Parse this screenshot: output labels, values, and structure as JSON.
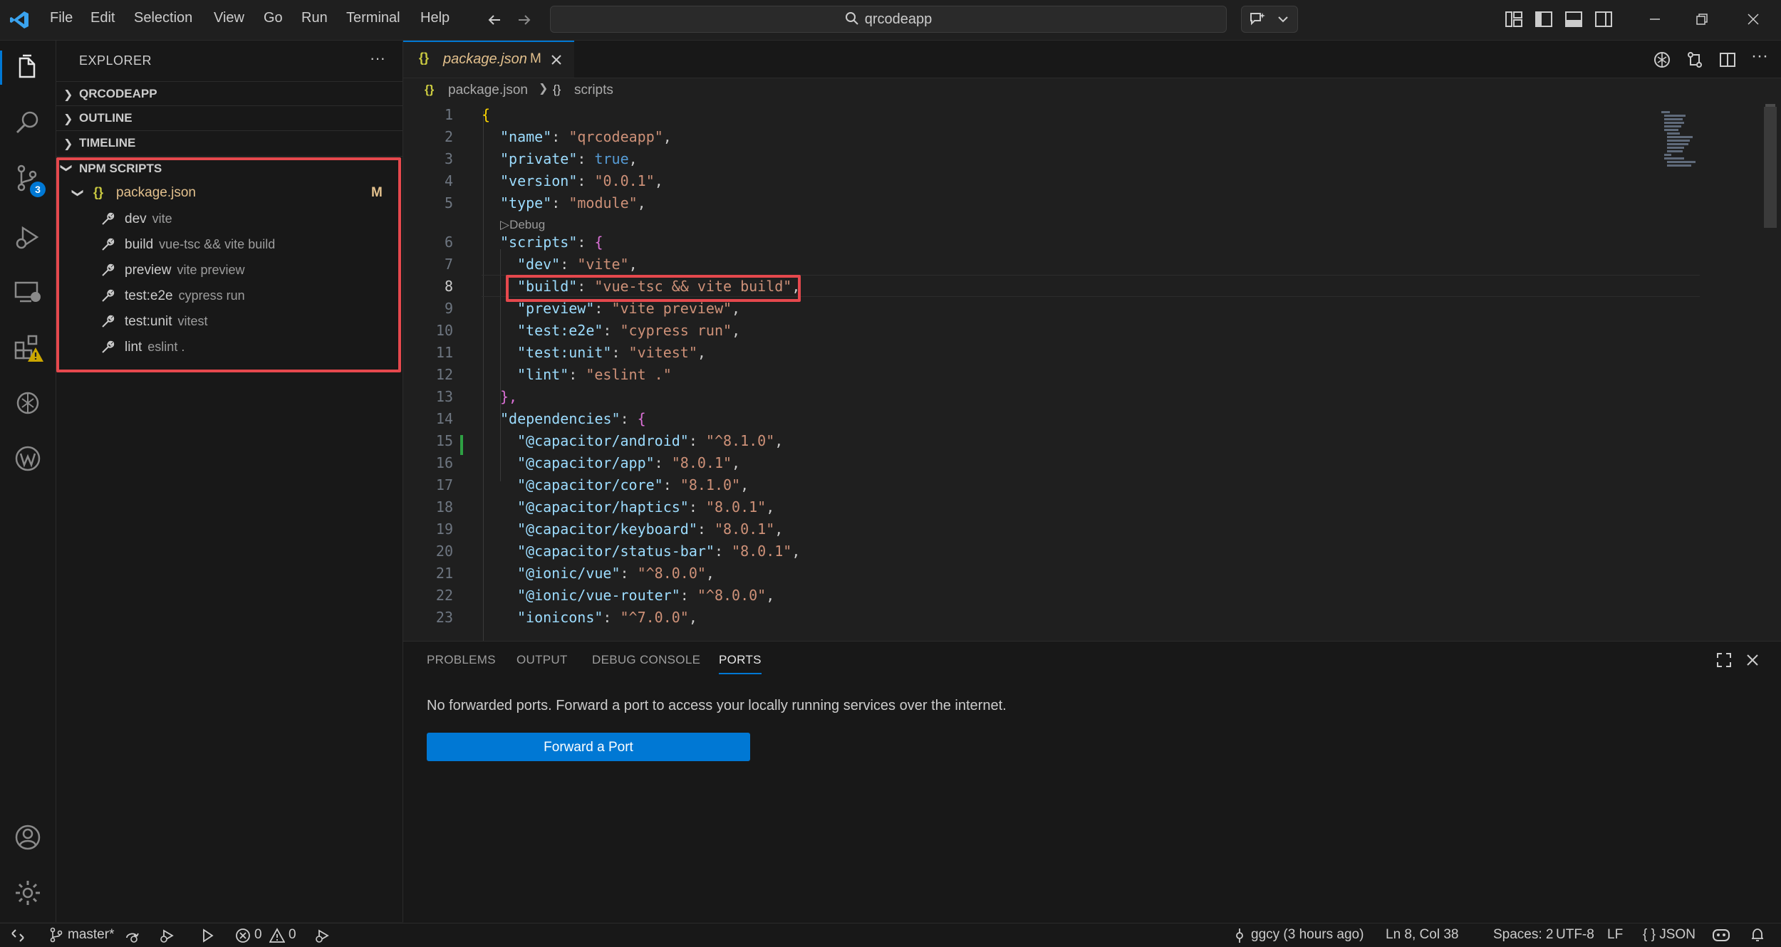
{
  "window": {
    "search": "qrcodeapp"
  },
  "menu": [
    "File",
    "Edit",
    "Selection",
    "View",
    "Go",
    "Run",
    "Terminal",
    "Help"
  ],
  "activity": {
    "scm_badge": "3"
  },
  "sidebar": {
    "title": "EXPLORER",
    "sections": [
      {
        "label": "QRCODEAPP"
      },
      {
        "label": "OUTLINE"
      },
      {
        "label": "TIMELINE"
      },
      {
        "label": "NPM SCRIPTS"
      }
    ],
    "npm": {
      "file": "package.json",
      "file_status": "M",
      "scripts": [
        {
          "name": "dev",
          "cmd": "vite"
        },
        {
          "name": "build",
          "cmd": "vue-tsc && vite build"
        },
        {
          "name": "preview",
          "cmd": "vite preview"
        },
        {
          "name": "test:e2e",
          "cmd": "cypress run"
        },
        {
          "name": "test:unit",
          "cmd": "vitest"
        },
        {
          "name": "lint",
          "cmd": "eslint ."
        }
      ]
    }
  },
  "editor": {
    "tab": {
      "label": "package.json",
      "status": "M"
    },
    "breadcrumb": [
      "package.json",
      "scripts"
    ],
    "codelens": "Debug",
    "line_numbers": [
      "1",
      "2",
      "3",
      "4",
      "5",
      "6",
      "7",
      "8",
      "9",
      "10",
      "11",
      "12",
      "13",
      "14",
      "15",
      "16",
      "17",
      "18",
      "19",
      "20",
      "21",
      "22",
      "23"
    ],
    "code": {
      "l1": "{",
      "l2": {
        "key": "\"name\"",
        "val": "\"qrcodeapp\""
      },
      "l3": {
        "key": "\"private\"",
        "val": "true"
      },
      "l4": {
        "key": "\"version\"",
        "val": "\"0.0.1\""
      },
      "l5": {
        "key": "\"type\"",
        "val": "\"module\""
      },
      "l6": {
        "key": "\"scripts\"",
        "val": "{"
      },
      "l7": {
        "key": "\"dev\"",
        "val": "\"vite\""
      },
      "l8": {
        "key": "\"build\"",
        "val": "\"vue-tsc && vite build\""
      },
      "l9": {
        "key": "\"preview\"",
        "val": "\"vite preview\""
      },
      "l10": {
        "key": "\"test:e2e\"",
        "val": "\"cypress run\""
      },
      "l11": {
        "key": "\"test:unit\"",
        "val": "\"vitest\""
      },
      "l12": {
        "key": "\"lint\"",
        "val": "\"eslint .\""
      },
      "l13": "},",
      "l14": {
        "key": "\"dependencies\"",
        "val": "{"
      },
      "l15": {
        "key": "\"@capacitor/android\"",
        "val": "\"^8.1.0\""
      },
      "l16": {
        "key": "\"@capacitor/app\"",
        "val": "\"8.0.1\""
      },
      "l17": {
        "key": "\"@capacitor/core\"",
        "val": "\"8.1.0\""
      },
      "l18": {
        "key": "\"@capacitor/haptics\"",
        "val": "\"8.0.1\""
      },
      "l19": {
        "key": "\"@capacitor/keyboard\"",
        "val": "\"8.0.1\""
      },
      "l20": {
        "key": "\"@capacitor/status-bar\"",
        "val": "\"8.0.1\""
      },
      "l21": {
        "key": "\"@ionic/vue\"",
        "val": "\"^8.0.0\""
      },
      "l22": {
        "key": "\"@ionic/vue-router\"",
        "val": "\"^8.0.0\""
      },
      "l23": {
        "key": "\"ionicons\"",
        "val": "\"^7.0.0\""
      }
    }
  },
  "panel": {
    "tabs": [
      "PROBLEMS",
      "OUTPUT",
      "DEBUG CONSOLE",
      "PORTS"
    ],
    "message": "No forwarded ports. Forward a port to access your locally running services over the internet.",
    "button": "Forward a Port"
  },
  "status": {
    "branch": "master*",
    "errors": "0",
    "warnings": "0",
    "blame": "ggcy (3 hours ago)",
    "position": "Ln 8, Col 38",
    "spaces": "Spaces: 2",
    "encoding": "UTF-8",
    "eol": "LF",
    "language": "JSON"
  },
  "colors": {
    "accent": "#0078d4",
    "highlight": "#e5484d",
    "background": "#1f1f1f"
  }
}
